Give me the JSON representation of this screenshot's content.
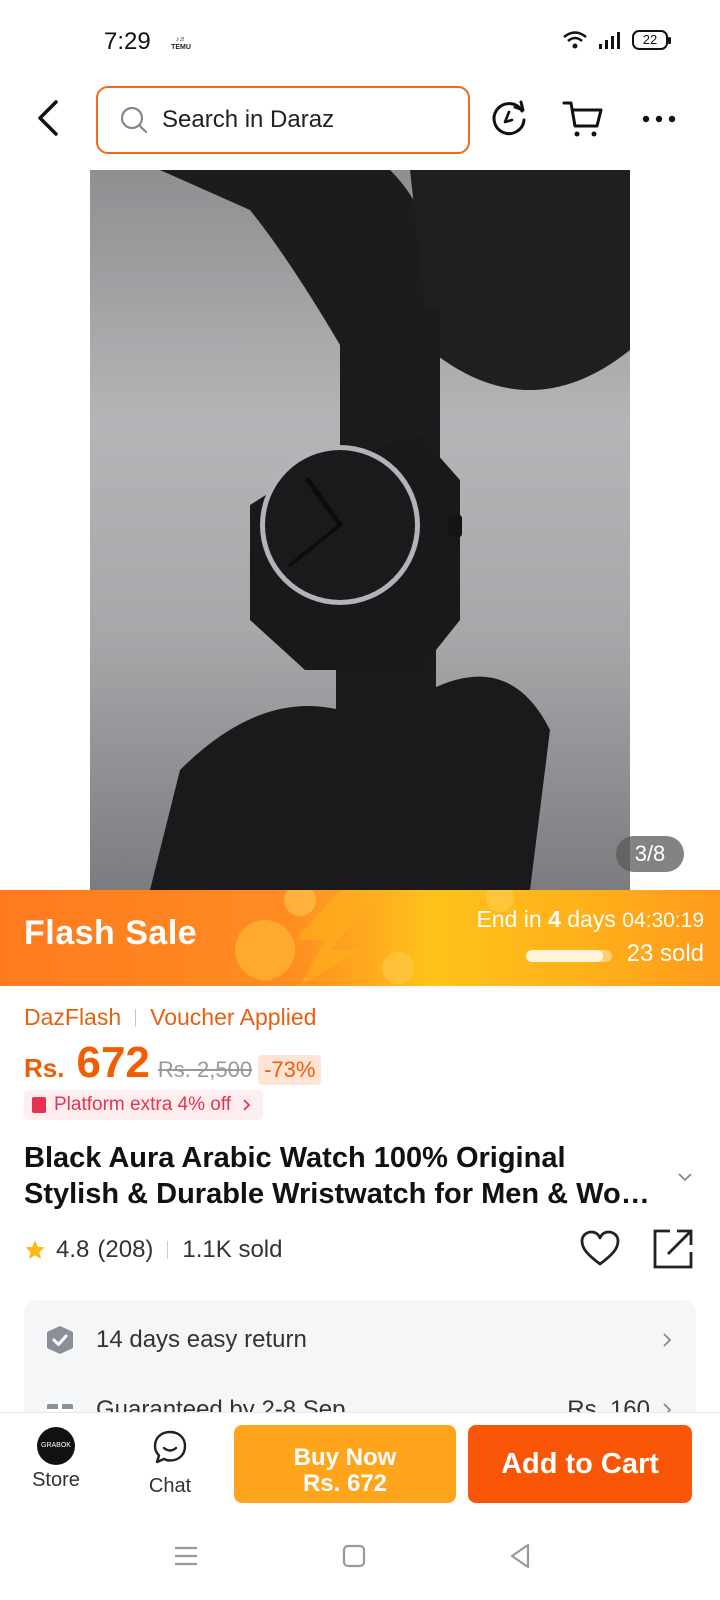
{
  "status": {
    "time": "7:29",
    "temu_badge": "TEMU",
    "battery": "22"
  },
  "header": {
    "search_placeholder": "Search in Daraz"
  },
  "gallery": {
    "counter": "3/8"
  },
  "flash_sale": {
    "title": "Flash Sale",
    "end_prefix": "End in",
    "days_count": "4",
    "days_label": "days",
    "timer": "04:30:19",
    "sold": "23 sold",
    "sold_progress": 0.9
  },
  "price": {
    "tag_primary": "DazFlash",
    "tag_secondary": "Voucher Applied",
    "currency": "Rs.",
    "current": "672",
    "original": "Rs. 2,500",
    "discount": "-73%",
    "platform_offer": "Platform extra 4% off"
  },
  "product": {
    "title_line1": "Black Aura Arabic Watch 100% Original",
    "title_line2": "Stylish & Durable Wristwatch for Men & Wo…",
    "rating": "4.8",
    "reviews": "(208)",
    "sold": "1.1K sold"
  },
  "services": [
    {
      "label": "14 days easy return",
      "value": ""
    },
    {
      "label": "Guaranteed by 2-8 Sep",
      "value": "Rs. 160"
    }
  ],
  "bottom_bar": {
    "store_label": "Store",
    "store_logo_text": "GRABOK",
    "chat_label": "Chat",
    "buy_now_line1": "Buy Now",
    "buy_now_line2": "Rs. 672",
    "add_to_cart": "Add to Cart"
  },
  "colors": {
    "accent": "#f85606",
    "flash_orange": "#ff7a1f",
    "buy_now": "#ffa51c",
    "search_border": "#f36a1c"
  },
  "icons": [
    "back-arrow-icon",
    "search-icon",
    "history-icon",
    "cart-icon",
    "more-icon",
    "star-icon",
    "heart-icon",
    "share-icon",
    "shield-check-icon",
    "gift-icon",
    "chat-icon",
    "menu-nav-icon",
    "home-nav-icon",
    "back-nav-icon"
  ]
}
